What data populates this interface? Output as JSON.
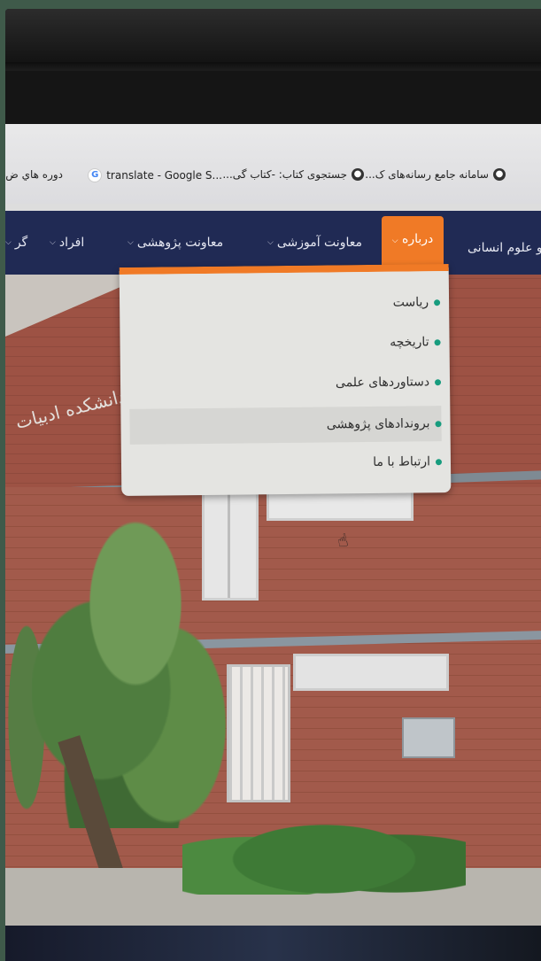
{
  "bookmarks": [
    {
      "label": "سامانه جامع رسانه‌های ک...",
      "icon": "globe-icon"
    },
    {
      "label": "جستجوی کتاب: -کتاب گی...",
      "icon": "globe-icon"
    },
    {
      "label": "translate - Google S...",
      "icon": "google-icon"
    },
    {
      "label": "دوره هاي ض",
      "icon": ""
    }
  ],
  "nav": {
    "site_title": "و علوم انسانی",
    "items": [
      {
        "label": "درباره"
      },
      {
        "label": "معاونت آموزشی"
      },
      {
        "label": "معاونت پژوهشی"
      },
      {
        "label": "افراد"
      },
      {
        "label": "گر"
      }
    ]
  },
  "dropdown": {
    "items": [
      {
        "label": "ریاست"
      },
      {
        "label": "تاریخچه"
      },
      {
        "label": "دستاوردهای علمی"
      },
      {
        "label": "بروندادهای پژوهشی"
      },
      {
        "label": "ارتباط با ما"
      }
    ]
  },
  "hero": {
    "building_sign": "دانشکده ادبیات"
  },
  "colors": {
    "nav_bg": "#202a54",
    "accent": "#f07a26",
    "bullet": "#179c7e"
  }
}
